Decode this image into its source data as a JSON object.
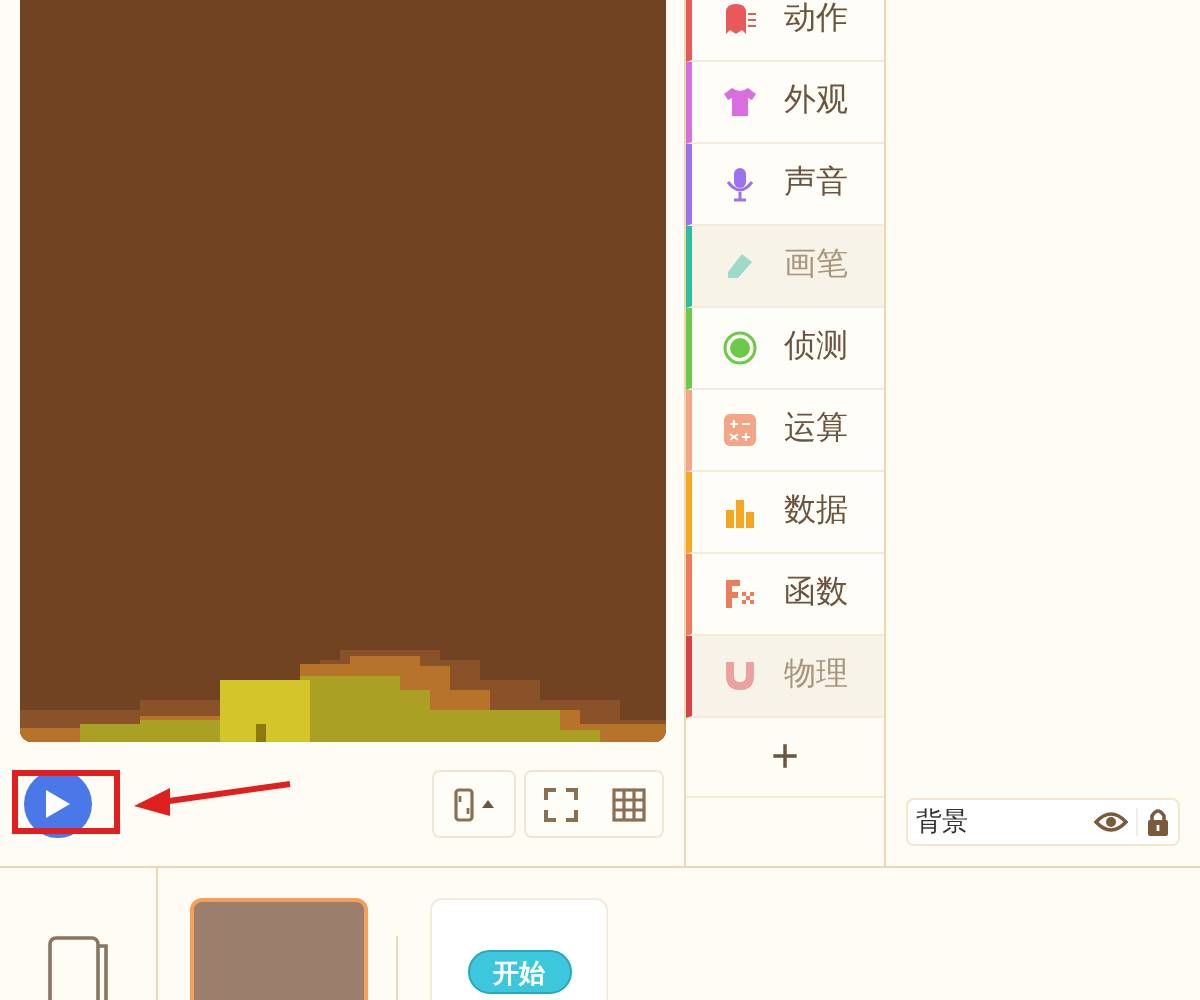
{
  "categories": [
    {
      "label": "动作",
      "color": "#e85a5a",
      "disabled": false
    },
    {
      "label": "外观",
      "color": "#d96ee0",
      "disabled": false
    },
    {
      "label": "声音",
      "color": "#9b72ee",
      "disabled": false
    },
    {
      "label": "画笔",
      "color": "#2bbfa0",
      "disabled": true
    },
    {
      "label": "侦测",
      "color": "#6cc94a",
      "disabled": false
    },
    {
      "label": "运算",
      "color": "#f4a585",
      "disabled": false
    },
    {
      "label": "数据",
      "color": "#f5a623",
      "disabled": false
    },
    {
      "label": "函数",
      "color": "#ee7c5a",
      "disabled": false
    },
    {
      "label": "物理",
      "color": "#d9404a",
      "disabled": true
    }
  ],
  "add_button": "+",
  "layer_field": {
    "value": "背景"
  },
  "start_card": {
    "label": "开始"
  }
}
